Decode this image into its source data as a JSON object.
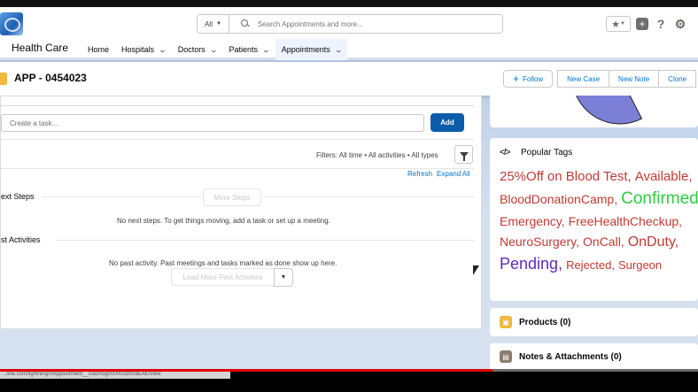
{
  "header": {
    "search_scope": "All",
    "search_placeholder": "Search Appointments and more..."
  },
  "nav": {
    "app_name": "Health Care",
    "items": [
      {
        "label": "Home",
        "dropdown": false
      },
      {
        "label": "Hospitals",
        "dropdown": true
      },
      {
        "label": "Doctors",
        "dropdown": true
      },
      {
        "label": "Patients",
        "dropdown": true
      },
      {
        "label": "Appointments",
        "dropdown": true,
        "active": true
      }
    ]
  },
  "record": {
    "title": "APP - 0454023",
    "actions": [
      "Follow",
      "New Case",
      "New Note",
      "Clone"
    ]
  },
  "activity": {
    "task_placeholder": "Create a task...",
    "add_label": "Add",
    "filters_text": "Filters: All time • All activities • All types",
    "refresh_label": "Refresh",
    "expand_label": "Expand All",
    "next_steps_title": "ext Steps",
    "more_steps_label": "More Steps",
    "next_steps_empty": "No next steps. To get things moving, add a task or set up a meeting.",
    "past_title": "st Activities",
    "past_empty": "No past activity. Past meetings and tasks marked as done show up here.",
    "load_more_label": "Load More Past Activities"
  },
  "pie": {
    "colors": [
      "#7b7fd6",
      "#f5a6bf"
    ],
    "slice_fractions": [
      0.62,
      0.38
    ]
  },
  "popular_tags": {
    "title": "Popular Tags",
    "tags": [
      {
        "text": "25%Off on Blood Test,",
        "size": 15,
        "color": "#c23934"
      },
      {
        "text": "Available,",
        "size": 15,
        "color": "#c23934"
      },
      {
        "text": "BloodDonationCamp,",
        "size": 14,
        "color": "#c23934"
      },
      {
        "text": "Confirmed,",
        "size": 19,
        "color": "#2ecc40"
      },
      {
        "text": "Emergency,",
        "size": 14,
        "color": "#c23934"
      },
      {
        "text": "FreeHealthCheckup,",
        "size": 14,
        "color": "#c23934"
      },
      {
        "text": "NeuroSurgery,",
        "size": 14,
        "color": "#c23934"
      },
      {
        "text": "OnCall,",
        "size": 14,
        "color": "#c23934"
      },
      {
        "text": "OnDuty,",
        "size": 16,
        "color": "#c23934"
      },
      {
        "text": "Pending,",
        "size": 18,
        "color": "#5b2bbf"
      },
      {
        "text": "Rejected,",
        "size": 13,
        "color": "#c23934"
      },
      {
        "text": "Surgeon",
        "size": 13,
        "color": "#c23934"
      }
    ]
  },
  "products": {
    "title": "Products (0)",
    "icon_color": "#f0b83f"
  },
  "notes": {
    "title": "Notes & Attachments (0)",
    "icon_color": "#8c7c6b"
  },
  "status_bar": {
    "url_text": "...one.com/lightning/r/Appointment__c/a0A5g000002dX0aEAE/view",
    "progress": 0.705
  }
}
